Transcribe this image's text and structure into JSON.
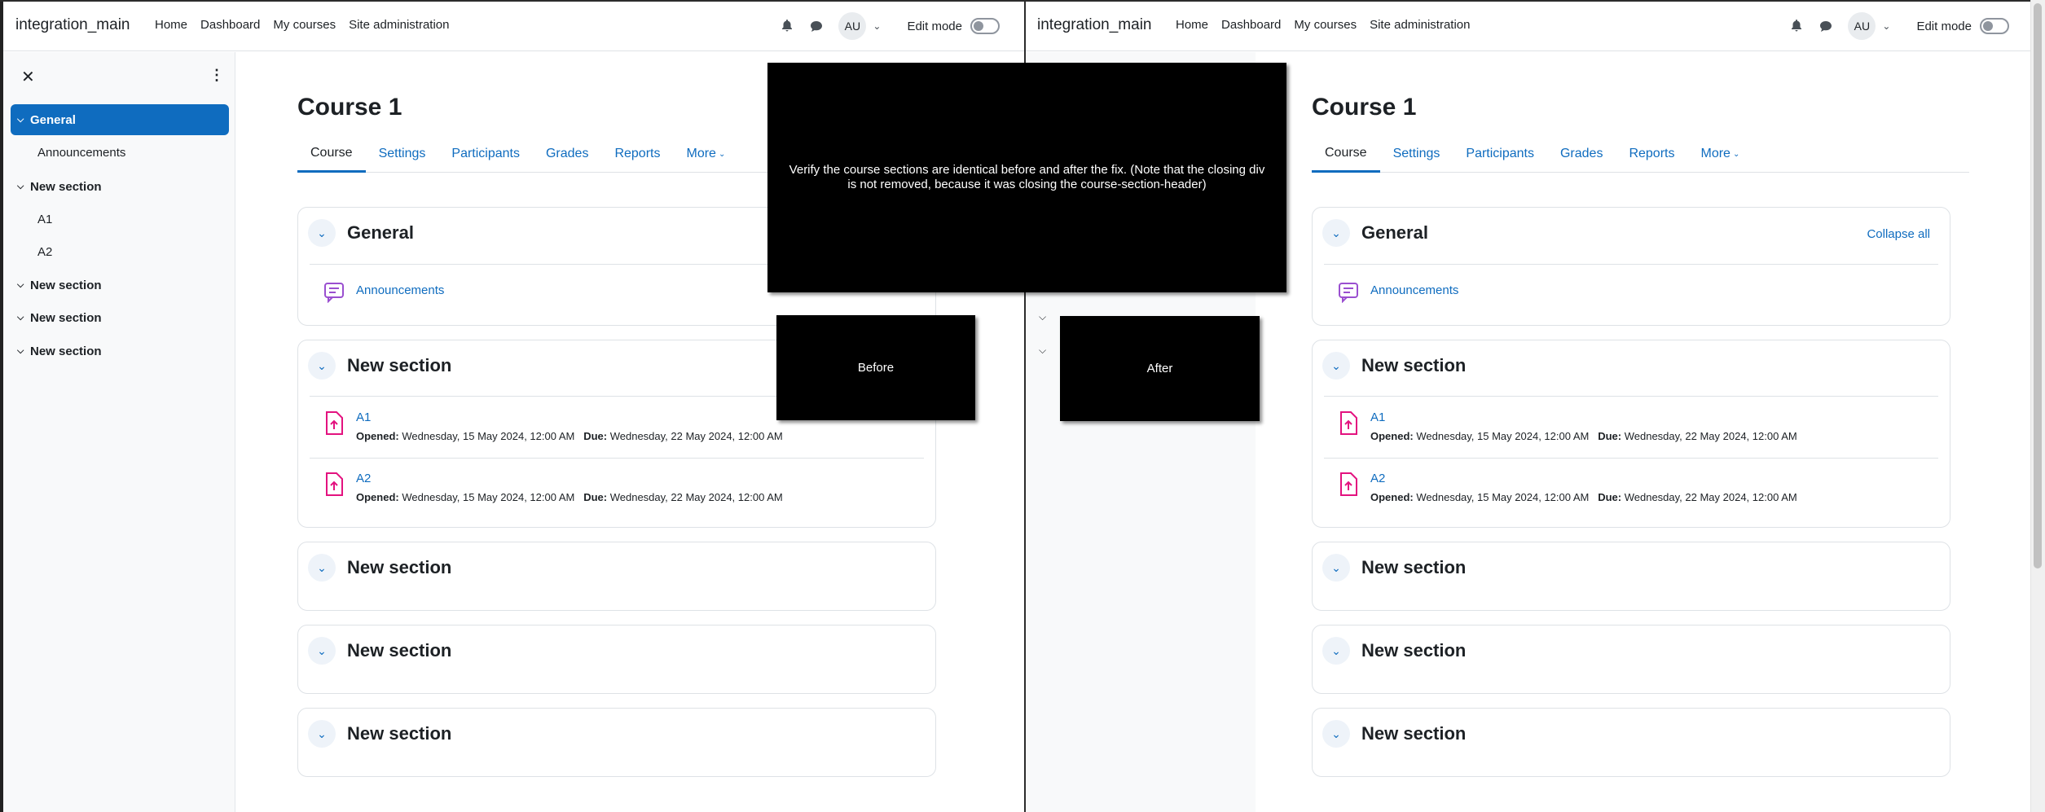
{
  "brand": "integration_main",
  "nav": {
    "home": "Home",
    "dashboard": "Dashboard",
    "my_courses": "My courses",
    "site_admin": "Site administration"
  },
  "user": {
    "initials": "AU",
    "edit_mode": "Edit mode"
  },
  "drawer": {
    "items": [
      {
        "label": "General",
        "active": true
      },
      {
        "label": "Announcements"
      },
      {
        "label": "New section"
      },
      {
        "label": "A1"
      },
      {
        "label": "A2"
      },
      {
        "label": "New section"
      },
      {
        "label": "New section"
      },
      {
        "label": "New section"
      }
    ]
  },
  "course": {
    "title": "Course 1",
    "tabs": [
      "Course",
      "Settings",
      "Participants",
      "Grades",
      "Reports",
      "More"
    ],
    "collapse_all": "Collapse all",
    "sections": [
      {
        "title": "General",
        "activities": [
          {
            "name": "Announcements",
            "type": "forum"
          }
        ]
      },
      {
        "title": "New section",
        "activities": [
          {
            "name": "A1",
            "type": "assign",
            "opened_label": "Opened:",
            "opened": "Wednesday, 15 May 2024, 12:00 AM",
            "due_label": "Due:",
            "due": "Wednesday, 22 May 2024, 12:00 AM"
          },
          {
            "name": "A2",
            "type": "assign",
            "opened_label": "Opened:",
            "opened": "Wednesday, 15 May 2024, 12:00 AM",
            "due_label": "Due:",
            "due": "Wednesday, 22 May 2024, 12:00 AM"
          }
        ]
      },
      {
        "title": "New section",
        "activities": []
      },
      {
        "title": "New section",
        "activities": []
      },
      {
        "title": "New section",
        "activities": []
      }
    ]
  },
  "overlays": {
    "note": "Verify the course sections are identical before and after the fix. (Note that the closing div is not removed, because it was closing the course-section-header)",
    "before": "Before",
    "after": "After"
  },
  "colors": {
    "accent": "#0f6cbf",
    "assign_icon": "#e3127f",
    "forum_icon": "#9a4fd0"
  }
}
